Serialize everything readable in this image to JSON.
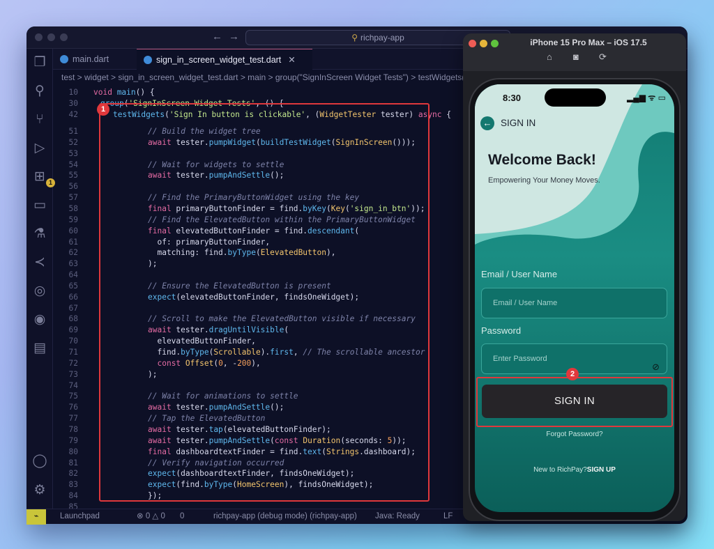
{
  "window": {
    "command_center": "richpay-app",
    "breadcrumb": "test > widget > sign_in_screen_widget_test.dart > main > group(\"SignInScreen Widget Tests\") > testWidgets(\"Sign In button is"
  },
  "tabs": [
    {
      "label": "main.dart",
      "active": false
    },
    {
      "label": "sign_in_screen_widget_test.dart",
      "active": true
    }
  ],
  "activity_bar": {
    "extensions_badge": "1",
    "icons": [
      "files-icon",
      "search-icon",
      "source-control-icon",
      "run-debug-icon",
      "extensions-icon",
      "remote-explorer-icon",
      "testing-icon",
      "flutter-icon",
      "gitlens-icon",
      "github-icon",
      "folder-icon",
      "account-icon",
      "settings-icon"
    ]
  },
  "markers": {
    "one": "1",
    "two": "2"
  },
  "code": {
    "header": [
      {
        "ln": "10",
        "text": "void main() {"
      },
      {
        "ln": "30",
        "text": "  group('SignInScreen Widget Tests', () {"
      },
      {
        "ln": "42",
        "text": "testWidgets('Sign In button is clickable', (WidgetTester tester) async {"
      }
    ],
    "lines": [
      {
        "ln": "51",
        "text": "// Build the widget tree"
      },
      {
        "ln": "52",
        "text": "await tester.pumpWidget(buildTestWidget(SignInScreen()));"
      },
      {
        "ln": "53",
        "text": ""
      },
      {
        "ln": "54",
        "text": "// Wait for widgets to settle"
      },
      {
        "ln": "55",
        "text": "await tester.pumpAndSettle();"
      },
      {
        "ln": "56",
        "text": ""
      },
      {
        "ln": "57",
        "text": "// Find the PrimaryButtonWidget using the key"
      },
      {
        "ln": "58",
        "text": "final primaryButtonFinder = find.byKey(Key('sign_in_btn'));"
      },
      {
        "ln": "59",
        "text": "// Find the ElevatedButton within the PrimaryButtonWidget"
      },
      {
        "ln": "60",
        "text": "final elevatedButtonFinder = find.descendant("
      },
      {
        "ln": "61",
        "text": "  of: primaryButtonFinder,"
      },
      {
        "ln": "62",
        "text": "  matching: find.byType(ElevatedButton),"
      },
      {
        "ln": "63",
        "text": ");"
      },
      {
        "ln": "64",
        "text": ""
      },
      {
        "ln": "65",
        "text": "// Ensure the ElevatedButton is present"
      },
      {
        "ln": "66",
        "text": "expect(elevatedButtonFinder, findsOneWidget);"
      },
      {
        "ln": "67",
        "text": ""
      },
      {
        "ln": "68",
        "text": "// Scroll to make the ElevatedButton visible if necessary"
      },
      {
        "ln": "69",
        "text": "await tester.dragUntilVisible("
      },
      {
        "ln": "70",
        "text": "  elevatedButtonFinder,"
      },
      {
        "ln": "71",
        "text": "  find.byType(Scrollable).first, // The scrollable ancestor"
      },
      {
        "ln": "72",
        "text": "  const Offset(0, -200),"
      },
      {
        "ln": "73",
        "text": ");"
      },
      {
        "ln": "74",
        "text": ""
      },
      {
        "ln": "75",
        "text": "// Wait for animations to settle"
      },
      {
        "ln": "76",
        "text": "await tester.pumpAndSettle();"
      },
      {
        "ln": "77",
        "text": "// Tap the ElevatedButton"
      },
      {
        "ln": "78",
        "text": "await tester.tap(elevatedButtonFinder);"
      },
      {
        "ln": "79",
        "text": "await tester.pumpAndSettle(const Duration(seconds: 5));"
      },
      {
        "ln": "80",
        "text": "final dashboardtextFinder = find.text(Strings.dashboard);"
      },
      {
        "ln": "81",
        "text": "// Verify navigation occurred"
      },
      {
        "ln": "82",
        "text": "expect(dashboardtextFinder, findsOneWidget);"
      },
      {
        "ln": "83",
        "text": "expect(find.byType(HomeScreen), findsOneWidget);"
      },
      {
        "ln": "84",
        "text": "});"
      },
      {
        "ln": "85",
        "text": ""
      }
    ]
  },
  "statusbar": {
    "remote": "⌁",
    "launchpad": "Launchpad",
    "problems": "⊗ 0 △ 0",
    "ports": "0",
    "debug": "richpay-app (debug mode) (richpay-app)",
    "java": "Java: Ready",
    "eol": "LF"
  },
  "simulator": {
    "title": "iPhone 15 Pro Max – iOS 17.5"
  },
  "app": {
    "time": "8:30",
    "status_icons": "▂▄▆ ᯤ ▭",
    "header": "SIGN IN",
    "welcome": "Welcome Back!",
    "tagline": "Empowering Your Money Moves.",
    "email_label": "Email / User Name",
    "email_placeholder": "Email / User Name",
    "password_label": "Password",
    "password_placeholder": "Enter Password",
    "sign_in_button": "SIGN IN",
    "forgot": "Forgot Password?",
    "new_to": "New to RichPay?",
    "sign_up": "SIGN UP",
    "colors": {
      "accent": "#127b73",
      "highlight": "#e0383c"
    }
  }
}
